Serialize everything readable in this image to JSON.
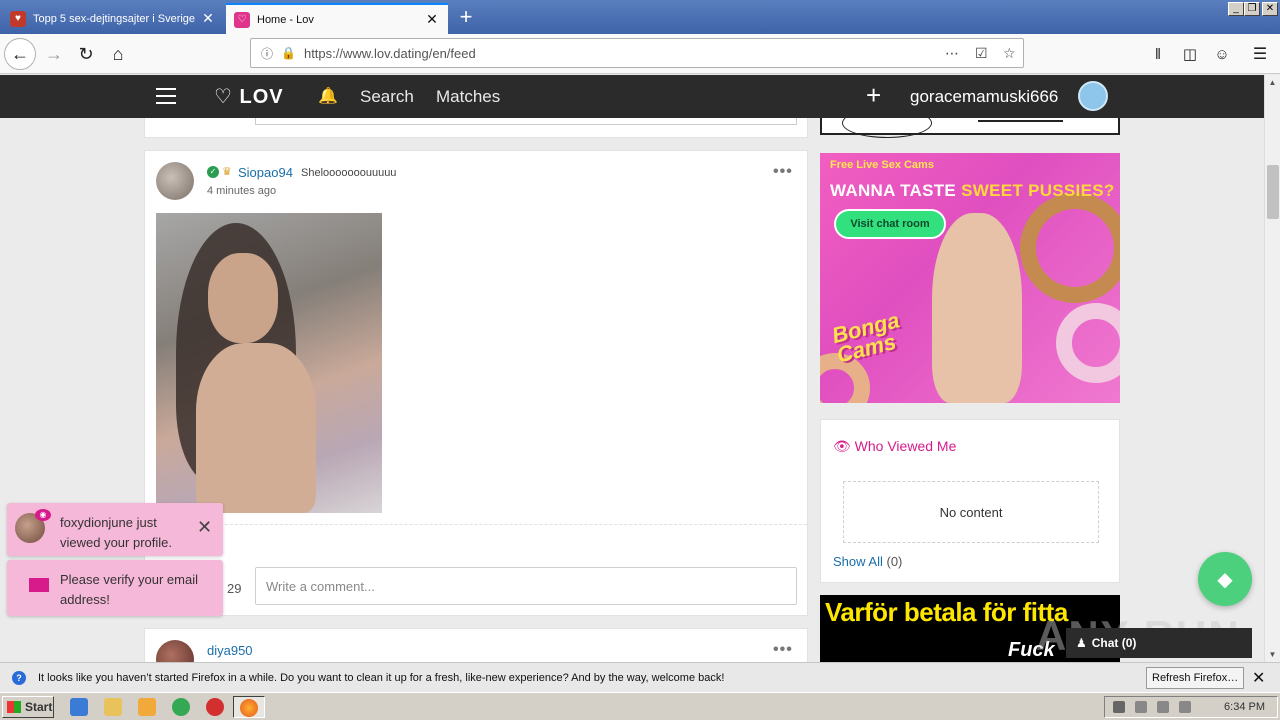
{
  "browser": {
    "tabs": [
      {
        "title": "Topp 5 sex-dejtingsajter i Sverige",
        "active": false
      },
      {
        "title": "Home - Lov",
        "active": true
      }
    ],
    "url": "https://www.lov.dating/en/feed",
    "notification": {
      "text": "It looks like you haven’t started Firefox in a while. Do you want to clean it up for a fresh, like-new experience? And by the way, welcome back!",
      "button_label": "Refresh Firefox…"
    }
  },
  "header": {
    "logo": "LOV",
    "nav": {
      "search": "Search",
      "matches": "Matches"
    },
    "username": "goracemamuski666"
  },
  "feed": {
    "post": {
      "username": "Siopao94",
      "text": "Shelooooooouuuuu",
      "time": "4 minutes ago",
      "like_count": "29",
      "comment_placeholder": "Write a comment..."
    },
    "next_post": {
      "username": "diya950"
    }
  },
  "sidebar": {
    "ad1": {
      "small": "Free Live Sex Cams",
      "headline_a": "WANNA TASTE ",
      "headline_b": "SWEET PUSSIES?",
      "button": "Visit chat room",
      "brand_line1": "Bonga",
      "brand_line2": "Cams"
    },
    "who_viewed": {
      "title": "Who Viewed Me",
      "empty": "No content",
      "show_all": "Show All",
      "count": "(0)"
    },
    "ad2": {
      "headline": "Varför betala för fitta",
      "sub": "Fuck"
    }
  },
  "chat": {
    "label": "Chat (0)"
  },
  "watermark": "ANY RUN",
  "toasts": [
    {
      "text": "foxydionjune just viewed your profile."
    },
    {
      "text": "Please verify your email address!"
    }
  ],
  "taskbar": {
    "start": "Start",
    "clock": "6:34 PM"
  },
  "colors": {
    "accent_pink": "#d81b8b",
    "link_blue": "#1a6ea8",
    "header_dark": "#2b2b2b",
    "chat_green": "#4cd07e"
  }
}
